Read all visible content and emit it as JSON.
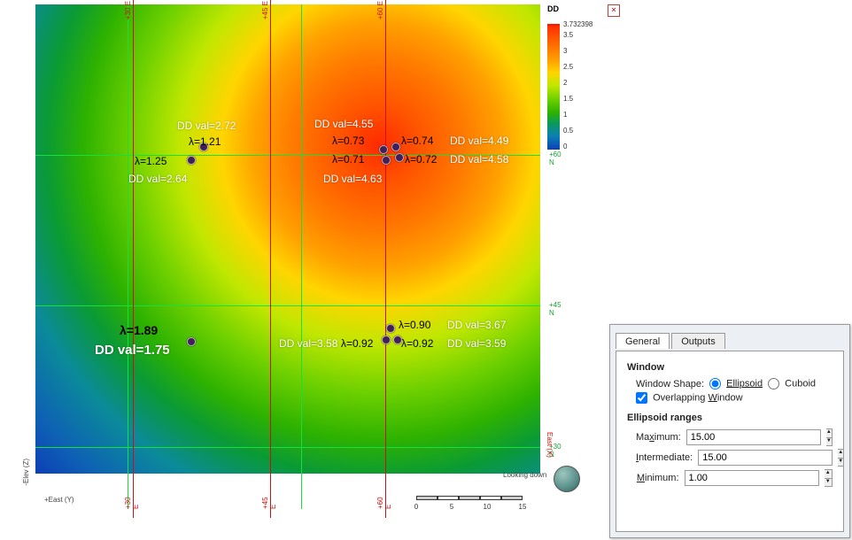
{
  "legend": {
    "title": "DD",
    "max_value": "3.732398",
    "ticks": [
      "3.5",
      "3",
      "2.5",
      "2",
      "1.5",
      "1",
      "0.5",
      "0"
    ]
  },
  "grid": {
    "green_h_labels": [
      "+60 N",
      "+45 N",
      "+30 N"
    ],
    "red_v_labels": [
      "+30 E",
      "+45 E",
      "+60 E"
    ]
  },
  "points": {
    "p1": {
      "lambda": "λ=1.25",
      "dd": "DD val=2.64"
    },
    "p2": {
      "lambda": "λ=1.21",
      "dd": "DD val=2.72"
    },
    "p3": {
      "lambda": "λ=0.73",
      "dd": "DD val=4.55"
    },
    "p4": {
      "lambda": "λ=0.74",
      "dd": "DD val=4.49"
    },
    "p5": {
      "lambda": "λ=0.71",
      "dd": "DD val=4.63"
    },
    "p6": {
      "lambda": "λ=0.72",
      "dd": "DD val=4.58"
    },
    "p7": {
      "lambda": "λ=1.89",
      "dd": "DD val=1.75"
    },
    "p8": {
      "lambda": "λ=0.92",
      "dd": "DD val=3.58"
    },
    "p9": {
      "lambda": "λ=0.90",
      "dd": "DD val=3.67"
    },
    "p10": {
      "lambda": "λ=0.92",
      "dd": "DD val=3.59"
    }
  },
  "footer": {
    "looking": "Looking down",
    "axis_z": "-Elev (Z)",
    "axis_x": "+East (Y)",
    "scale_ticks": [
      "0",
      "5",
      "10",
      "15"
    ],
    "east_side": "East (X)"
  },
  "dialog": {
    "tabs": {
      "general": "General",
      "outputs": "Outputs"
    },
    "window_section": "Window",
    "shape_label": "Window Shape:",
    "shape_ellipsoid": "Ellipsoid",
    "shape_cuboid": "Cuboid",
    "overlap_label": "Overlapping Window",
    "ranges_section": "Ellipsoid ranges",
    "max_label": "Maximum:",
    "max_under": "x",
    "int_label": "Intermediate:",
    "int_under": "I",
    "min_label": "Minimum:",
    "min_under": "M",
    "max_value": "15.00",
    "int_value": "15.00",
    "min_value": "1.00"
  }
}
